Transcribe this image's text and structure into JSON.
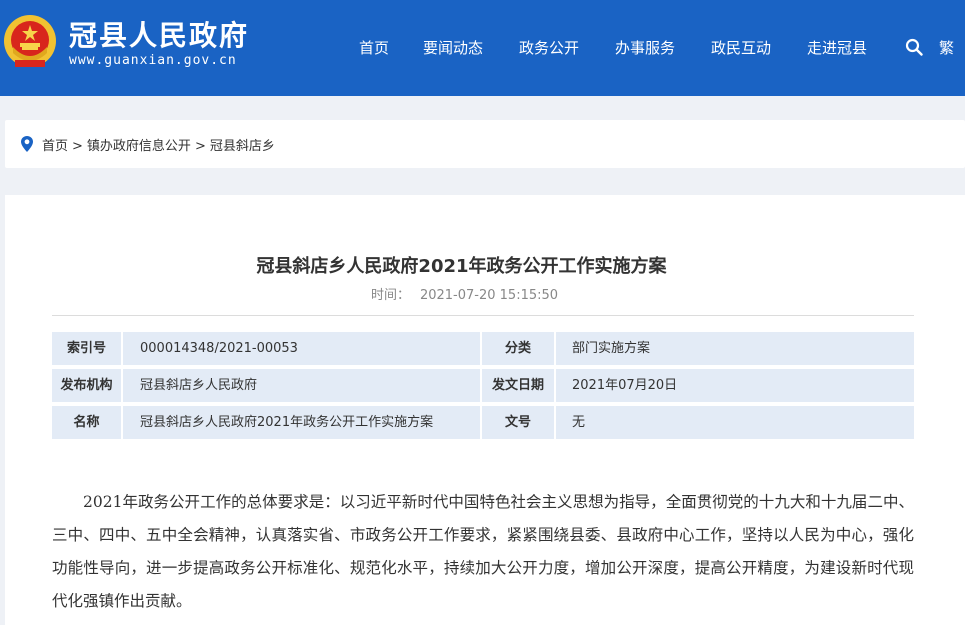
{
  "header": {
    "site_name": "冠县人民政府",
    "site_url": "www.guanxian.gov.cn",
    "emblem_icon": "national-emblem-icon",
    "nav": [
      "首页",
      "要闻动态",
      "政务公开",
      "办事服务",
      "政民互动",
      "走进冠县"
    ],
    "search_icon": "search-icon",
    "lang_toggle": "繁",
    "colors": {
      "header_bg": "#1a63c4",
      "page_bg": "#eef1f6",
      "table_cell_bg": "#e3ebf6"
    }
  },
  "breadcrumb": {
    "icon": "location-pin-icon",
    "items": [
      "首页",
      "镇办政府信息公开",
      "冠县斜店乡"
    ],
    "separator": ">"
  },
  "article": {
    "title": "冠县斜店乡人民政府2021年政务公开工作实施方案",
    "time_label": "时间：",
    "time_value": "2021-07-20 15:15:50",
    "meta": [
      {
        "k1": "索引号",
        "v1": "000014348/2021-00053",
        "k2": "分类",
        "v2": "部门实施方案"
      },
      {
        "k1": "发布机构",
        "v1": "冠县斜店乡人民政府",
        "k2": "发文日期",
        "v2": "2021年07月20日"
      },
      {
        "k1": "名称",
        "v1": "冠县斜店乡人民政府2021年政务公开工作实施方案",
        "k2": "文号",
        "v2": "无"
      }
    ],
    "paragraph": "2021年政务公开工作的总体要求是：以习近平新时代中国特色社会主义思想为指导，全面贯彻党的十九大和十九届二中、三中、四中、五中全会精神，认真落实省、市政务公开工作要求，紧紧围绕县委、县政府中心工作，坚持以人民为中心，强化功能性导向，进一步提高政务公开标准化、规范化水平，持续加大公开力度，增加公开深度，提高公开精度，为建设新时代现代化强镇作出贡献。"
  }
}
